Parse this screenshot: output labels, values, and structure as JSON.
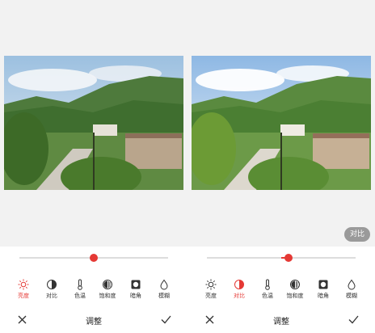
{
  "screens": [
    {
      "active_tool": "brightness",
      "slider_value": 0.5,
      "slider_fill_from_center": 0,
      "tools": [
        {
          "id": "brightness",
          "label": "亮度",
          "icon": "sun-icon"
        },
        {
          "id": "contrast",
          "label": "对比",
          "icon": "contrast-icon"
        },
        {
          "id": "temperature",
          "label": "色温",
          "icon": "thermometer-icon"
        },
        {
          "id": "saturation",
          "label": "饱和度",
          "icon": "saturation-icon"
        },
        {
          "id": "vignette",
          "label": "暗角",
          "icon": "vignette-icon"
        },
        {
          "id": "blur",
          "label": "模糊",
          "icon": "blur-drop-icon"
        }
      ],
      "bottom": {
        "title": "调整",
        "cancel_icon": "close-icon",
        "confirm_icon": "check-icon"
      }
    },
    {
      "active_tool": "contrast",
      "slider_value": 0.55,
      "compare_label": "对比",
      "tools": [
        {
          "id": "brightness",
          "label": "亮度",
          "icon": "sun-icon"
        },
        {
          "id": "contrast",
          "label": "对比",
          "icon": "contrast-icon"
        },
        {
          "id": "temperature",
          "label": "色温",
          "icon": "thermometer-icon"
        },
        {
          "id": "saturation",
          "label": "饱和度",
          "icon": "saturation-icon"
        },
        {
          "id": "vignette",
          "label": "暗角",
          "icon": "vignette-icon"
        },
        {
          "id": "blur",
          "label": "模糊",
          "icon": "blur-drop-icon"
        }
      ],
      "bottom": {
        "title": "调整",
        "cancel_icon": "close-icon",
        "confirm_icon": "check-icon"
      }
    }
  ],
  "colors": {
    "accent": "#e53935",
    "track": "#dddddd",
    "text": "#333333"
  }
}
